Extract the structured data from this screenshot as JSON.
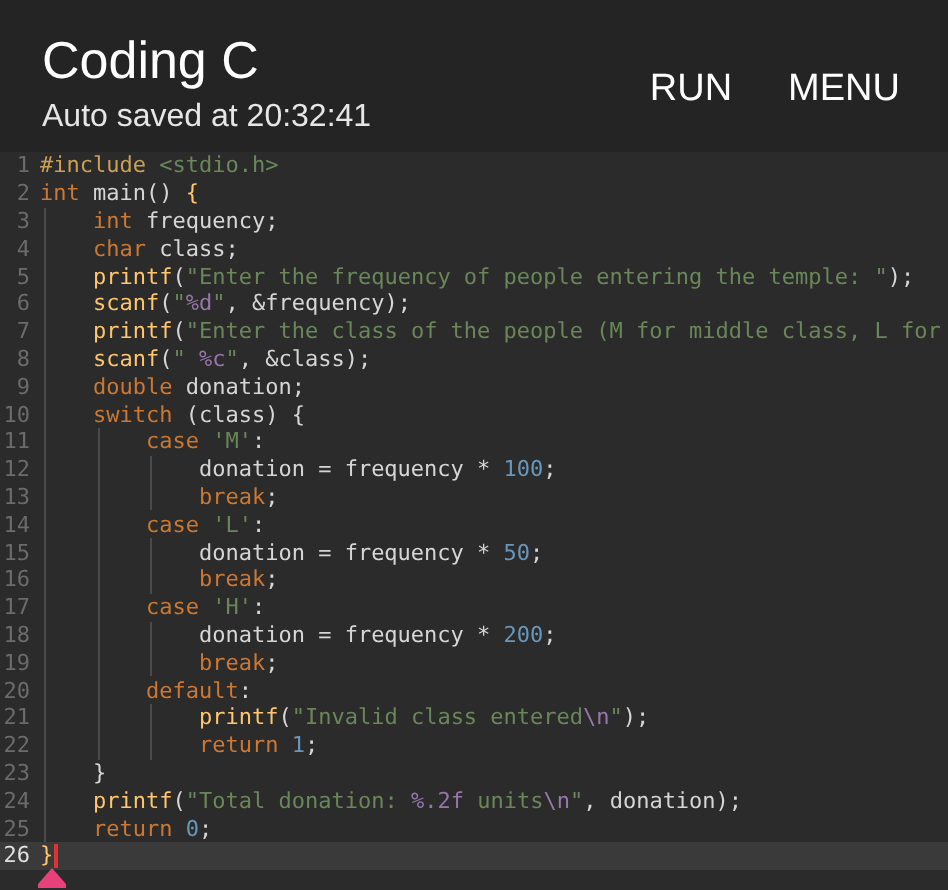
{
  "app_bar": {
    "title": "Coding C",
    "subtitle": "Auto saved at 20:32:41",
    "actions": [
      "RUN",
      "MENU"
    ]
  },
  "editor": {
    "lines": [
      {
        "number": "1",
        "current": false,
        "tokens": [
          {
            "kind": "pre",
            "text": "#include"
          },
          {
            "kind": "str",
            "text": " <stdio.h>"
          }
        ]
      },
      {
        "number": "2",
        "current": false,
        "tokens": [
          {
            "kind": "kw",
            "text": "int"
          },
          {
            "kind": "plain",
            "text": " main() "
          },
          {
            "kind": "fn",
            "text": "{"
          }
        ]
      },
      {
        "number": "3",
        "current": false,
        "tokens": [
          {
            "kind": "kw",
            "text": "    int"
          },
          {
            "kind": "plain",
            "text": " frequency;"
          }
        ]
      },
      {
        "number": "4",
        "current": false,
        "tokens": [
          {
            "kind": "kw",
            "text": "    char"
          },
          {
            "kind": "plain",
            "text": " class;"
          }
        ]
      },
      {
        "number": "5",
        "current": false,
        "tokens": [
          {
            "kind": "fn",
            "text": "    printf"
          },
          {
            "kind": "plain",
            "text": "("
          },
          {
            "kind": "str",
            "text": "\"Enter the frequency of people entering the temple: \""
          },
          {
            "kind": "plain",
            "text": ");"
          }
        ]
      },
      {
        "number": "6",
        "current": false,
        "tokens": [
          {
            "kind": "fn",
            "text": "    scanf"
          },
          {
            "kind": "plain",
            "text": "("
          },
          {
            "kind": "str",
            "text": "\""
          },
          {
            "kind": "fmt",
            "text": "%d"
          },
          {
            "kind": "str",
            "text": "\""
          },
          {
            "kind": "plain",
            "text": ", &frequency);"
          }
        ]
      },
      {
        "number": "7",
        "current": false,
        "tokens": [
          {
            "kind": "fn",
            "text": "    printf"
          },
          {
            "kind": "plain",
            "text": "("
          },
          {
            "kind": "str",
            "text": "\"Enter the class of the people (M for middle class, L for"
          }
        ]
      },
      {
        "number": "8",
        "current": false,
        "tokens": [
          {
            "kind": "fn",
            "text": "    scanf"
          },
          {
            "kind": "plain",
            "text": "("
          },
          {
            "kind": "str",
            "text": "\" "
          },
          {
            "kind": "fmt",
            "text": "%c"
          },
          {
            "kind": "str",
            "text": "\""
          },
          {
            "kind": "plain",
            "text": ", &class);"
          }
        ]
      },
      {
        "number": "9",
        "current": false,
        "tokens": [
          {
            "kind": "kw",
            "text": "    double"
          },
          {
            "kind": "plain",
            "text": " donation;"
          }
        ]
      },
      {
        "number": "10",
        "current": false,
        "tokens": [
          {
            "kind": "kw",
            "text": "    switch"
          },
          {
            "kind": "plain",
            "text": " (class) {"
          }
        ]
      },
      {
        "number": "11",
        "current": false,
        "tokens": [
          {
            "kind": "kw",
            "text": "        case"
          },
          {
            "kind": "str",
            "text": " 'M'"
          },
          {
            "kind": "plain",
            "text": ":"
          }
        ]
      },
      {
        "number": "12",
        "current": false,
        "tokens": [
          {
            "kind": "plain",
            "text": "            donation = frequency * "
          },
          {
            "kind": "num",
            "text": "100"
          },
          {
            "kind": "plain",
            "text": ";"
          }
        ]
      },
      {
        "number": "13",
        "current": false,
        "tokens": [
          {
            "kind": "kw",
            "text": "            break"
          },
          {
            "kind": "plain",
            "text": ";"
          }
        ]
      },
      {
        "number": "14",
        "current": false,
        "tokens": [
          {
            "kind": "kw",
            "text": "        case"
          },
          {
            "kind": "str",
            "text": " 'L'"
          },
          {
            "kind": "plain",
            "text": ":"
          }
        ]
      },
      {
        "number": "15",
        "current": false,
        "tokens": [
          {
            "kind": "plain",
            "text": "            donation = frequency * "
          },
          {
            "kind": "num",
            "text": "50"
          },
          {
            "kind": "plain",
            "text": ";"
          }
        ]
      },
      {
        "number": "16",
        "current": false,
        "tokens": [
          {
            "kind": "kw",
            "text": "            break"
          },
          {
            "kind": "plain",
            "text": ";"
          }
        ]
      },
      {
        "number": "17",
        "current": false,
        "tokens": [
          {
            "kind": "kw",
            "text": "        case"
          },
          {
            "kind": "str",
            "text": " 'H'"
          },
          {
            "kind": "plain",
            "text": ":"
          }
        ]
      },
      {
        "number": "18",
        "current": false,
        "tokens": [
          {
            "kind": "plain",
            "text": "            donation = frequency * "
          },
          {
            "kind": "num",
            "text": "200"
          },
          {
            "kind": "plain",
            "text": ";"
          }
        ]
      },
      {
        "number": "19",
        "current": false,
        "tokens": [
          {
            "kind": "kw",
            "text": "            break"
          },
          {
            "kind": "plain",
            "text": ";"
          }
        ]
      },
      {
        "number": "20",
        "current": false,
        "tokens": [
          {
            "kind": "kw",
            "text": "        default"
          },
          {
            "kind": "plain",
            "text": ":"
          }
        ]
      },
      {
        "number": "21",
        "current": false,
        "tokens": [
          {
            "kind": "fn",
            "text": "            printf"
          },
          {
            "kind": "plain",
            "text": "("
          },
          {
            "kind": "str",
            "text": "\"Invalid class entered"
          },
          {
            "kind": "fmt",
            "text": "\\n"
          },
          {
            "kind": "str",
            "text": "\""
          },
          {
            "kind": "plain",
            "text": ");"
          }
        ]
      },
      {
        "number": "22",
        "current": false,
        "tokens": [
          {
            "kind": "kw",
            "text": "            return"
          },
          {
            "kind": "num",
            "text": " 1"
          },
          {
            "kind": "plain",
            "text": ";"
          }
        ]
      },
      {
        "number": "23",
        "current": false,
        "tokens": [
          {
            "kind": "plain",
            "text": "    }"
          }
        ]
      },
      {
        "number": "24",
        "current": false,
        "tokens": [
          {
            "kind": "fn",
            "text": "    printf"
          },
          {
            "kind": "plain",
            "text": "("
          },
          {
            "kind": "str",
            "text": "\"Total donation: "
          },
          {
            "kind": "fmt",
            "text": "%.2f"
          },
          {
            "kind": "str",
            "text": " units"
          },
          {
            "kind": "fmt",
            "text": "\\n"
          },
          {
            "kind": "str",
            "text": "\""
          },
          {
            "kind": "plain",
            "text": ", donation);"
          }
        ]
      },
      {
        "number": "25",
        "current": false,
        "tokens": [
          {
            "kind": "kw",
            "text": "    return"
          },
          {
            "kind": "num",
            "text": " 0"
          },
          {
            "kind": "plain",
            "text": ";"
          }
        ]
      },
      {
        "number": "26",
        "current": true,
        "tokens": [
          {
            "kind": "fn",
            "text": "}"
          }
        ]
      }
    ]
  }
}
